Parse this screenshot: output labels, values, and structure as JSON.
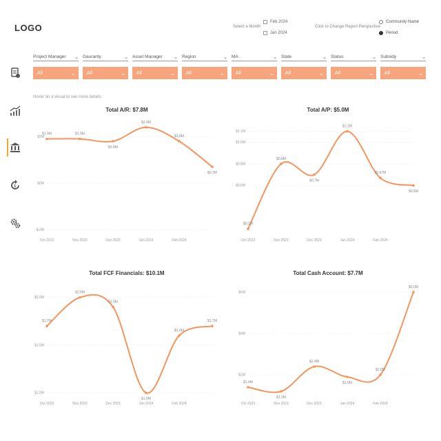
{
  "logo": "LOGO",
  "month_selector": {
    "label": "Select a Month",
    "options": [
      {
        "label": "Feb 2024",
        "checked": false
      },
      {
        "label": "Jan 2024",
        "checked": false
      }
    ]
  },
  "perspective": {
    "label": "Click to Change Report Perspective",
    "options": [
      {
        "label": "Community Name",
        "selected": false
      },
      {
        "label": "Period",
        "selected": true
      }
    ]
  },
  "sidebar": {
    "items": [
      {
        "icon": "report-icon",
        "active": false
      },
      {
        "icon": "trend-chart-icon",
        "active": false
      },
      {
        "icon": "bank-icon",
        "active": true
      },
      {
        "icon": "refresh-dollar-icon",
        "active": false
      },
      {
        "icon": "settings-gears-icon",
        "active": false
      }
    ]
  },
  "filters": [
    {
      "label": "Project Manager",
      "value": "All"
    },
    {
      "label": "Gauranty",
      "value": "All"
    },
    {
      "label": "Asset Manager",
      "value": "All"
    },
    {
      "label": "Region",
      "value": "All"
    },
    {
      "label": "MA",
      "value": "All"
    },
    {
      "label": "State",
      "value": "All"
    },
    {
      "label": "Status",
      "value": "All"
    },
    {
      "label": "Subsidy",
      "value": "All"
    }
  ],
  "hint": "Hover on a visual to see more details",
  "accent_color": "#f7a57d",
  "line_color": "#f5945c",
  "chart_data": [
    {
      "type": "line",
      "title": "Total A/R: $7.8M",
      "categories": [
        "Oct 2023",
        "Nov 2023",
        "Dec 2023",
        "Jan 2024",
        "Feb 2024",
        ""
      ],
      "values": [
        1.9,
        1.9,
        1.8,
        2.4,
        1.8,
        0.7
      ],
      "data_labels": [
        "$1.9M",
        "$1.9M",
        "$1.8M",
        "$2.4M",
        "$1.8M",
        "$0.7M"
      ],
      "y_ticks": [
        "$2M",
        "$0M",
        "$-2M"
      ],
      "grid": true
    },
    {
      "type": "line",
      "title": "Total A/P: $5.0M",
      "categories": [
        "Oct 2023",
        "Nov 2023",
        "Dec 2023",
        "Jan 2024",
        "Feb 2024",
        ""
      ],
      "values": [
        0.2,
        0.8,
        0.7,
        1.1,
        0.67,
        0.6
      ],
      "data_labels": [
        "$0.2M",
        "$0.8M",
        "$0.7M",
        "$1.1M",
        "$0.67M",
        "$0.6M"
      ],
      "y_ticks": [
        "$1.1M",
        "$1.0M",
        "$0.8M",
        "$0.6M"
      ],
      "grid": true
    },
    {
      "type": "line",
      "title": "Total FCF Financials: $10.1M",
      "categories": [
        "Oct 2023",
        "Nov 2023",
        "Dec 2023",
        "Jan 2024",
        "Feb 2024",
        ""
      ],
      "values": [
        1.7,
        2.0,
        1.9,
        1.0,
        1.6,
        1.7
      ],
      "data_labels": [
        "$1.7M",
        "$2.0M",
        "$1.9M",
        "$1.0M",
        "$1.6M",
        "$1.7M"
      ],
      "y_ticks": [
        "$2.0M",
        "$1.5M",
        "$1.0M"
      ],
      "grid": true
    },
    {
      "type": "line",
      "title": "Total Cash Account: $7.7M",
      "categories": [
        "Oct 2023",
        "Nov 2023",
        "Dec 2023",
        "Jan 2024",
        "Feb 2024",
        ""
      ],
      "values": [
        1.4,
        1.2,
        2.4,
        1.9,
        2.0,
        6.0
      ],
      "data_labels": [
        "$1.4M",
        "$1.2M",
        "$2.4M",
        "$1.9M",
        "$2.0M",
        "$6.0M"
      ],
      "y_ticks": [
        "$6M",
        "$4M",
        "$2M"
      ],
      "grid": true
    }
  ]
}
